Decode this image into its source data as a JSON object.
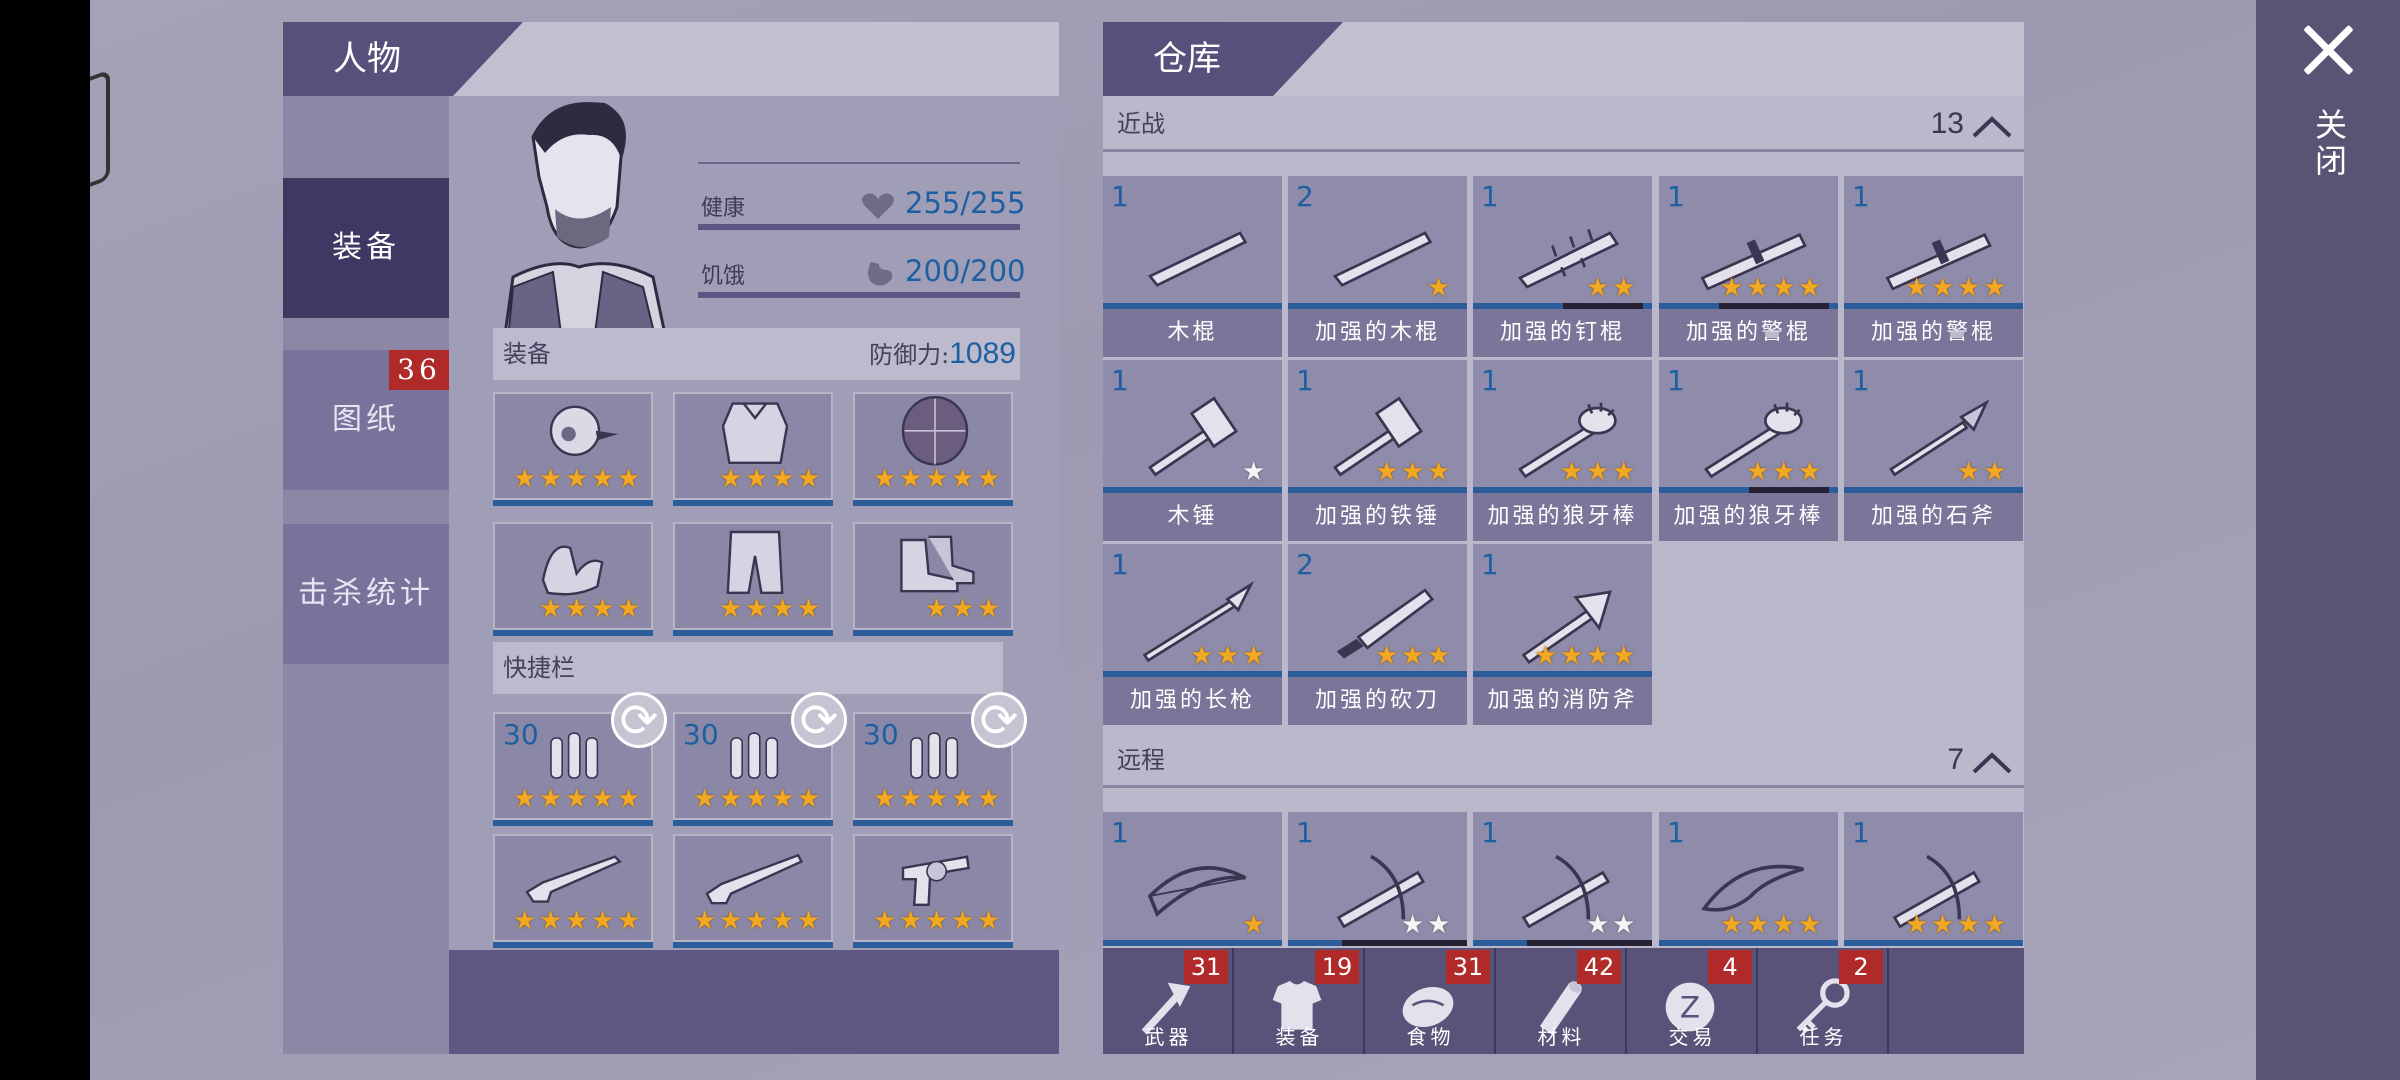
{
  "close": {
    "label": "关闭"
  },
  "character": {
    "title": "人物",
    "nav": [
      {
        "label": "装备",
        "active": true
      },
      {
        "label": "图纸",
        "badge": "36"
      },
      {
        "label": "击杀统计"
      }
    ],
    "health": {
      "label": "健康",
      "value": "255/255"
    },
    "hunger": {
      "label": "饥饿",
      "value": "200/200"
    },
    "equip_section": {
      "label": "装备",
      "defense_label": "防御力:",
      "defense_value": "1089"
    },
    "equipment": [
      {
        "icon": "helmet-icon",
        "stars": 5
      },
      {
        "icon": "armor-icon",
        "stars": 4
      },
      {
        "icon": "shield-icon",
        "stars": 5
      },
      {
        "icon": "gloves-icon",
        "stars": 4
      },
      {
        "icon": "pants-icon",
        "stars": 4
      },
      {
        "icon": "boots-icon",
        "stars": 3
      }
    ],
    "quick_section": {
      "label": "快捷栏"
    },
    "ammo": [
      {
        "icon": "ammo-icon",
        "qty": "30",
        "stars": 5
      },
      {
        "icon": "ammo-icon",
        "qty": "30",
        "stars": 5
      },
      {
        "icon": "ammo-icon",
        "qty": "30",
        "stars": 5
      }
    ],
    "guns": [
      {
        "icon": "rifle-icon",
        "stars": 5
      },
      {
        "icon": "shotgun-icon",
        "stars": 5
      },
      {
        "icon": "revolver-icon",
        "stars": 5
      }
    ]
  },
  "warehouse": {
    "title": "仓库",
    "melee": {
      "label": "近战",
      "count": "13"
    },
    "ranged": {
      "label": "远程",
      "count": "7"
    },
    "melee_items": [
      {
        "qty": "1",
        "name": "木棍",
        "stars": 0,
        "icon": "stick-icon"
      },
      {
        "qty": "2",
        "name": "加强的木棍",
        "stars": 1,
        "icon": "stick-icon"
      },
      {
        "qty": "1",
        "name": "加强的钉棍",
        "stars": 2,
        "icon": "nail-bat-icon"
      },
      {
        "qty": "1",
        "name": "加强的警棍",
        "stars": 4,
        "icon": "baton-icon"
      },
      {
        "qty": "1",
        "name": "加强的警棍",
        "stars": 4,
        "icon": "baton-icon"
      },
      {
        "qty": "1",
        "name": "木锤",
        "stars": 1,
        "white": true,
        "icon": "hammer-icon"
      },
      {
        "qty": "1",
        "name": "加强的铁锤",
        "stars": 3,
        "icon": "hammer-icon"
      },
      {
        "qty": "1",
        "name": "加强的狼牙棒",
        "stars": 3,
        "icon": "mace-icon"
      },
      {
        "qty": "1",
        "name": "加强的狼牙棒",
        "stars": 3,
        "icon": "mace-icon"
      },
      {
        "qty": "1",
        "name": "加强的石斧",
        "stars": 2,
        "icon": "stone-spear-icon"
      },
      {
        "qty": "1",
        "name": "加强的长枪",
        "stars": 3,
        "icon": "spear-icon"
      },
      {
        "qty": "2",
        "name": "加强的砍刀",
        "stars": 3,
        "icon": "machete-icon"
      },
      {
        "qty": "1",
        "name": "加强的消防斧",
        "stars": 4,
        "icon": "fire-axe-icon"
      }
    ],
    "ranged_items": [
      {
        "qty": "1",
        "stars": 1,
        "icon": "bow-icon"
      },
      {
        "qty": "1",
        "stars": 2,
        "white": true,
        "icon": "crossbow-icon"
      },
      {
        "qty": "1",
        "stars": 2,
        "white": true,
        "icon": "crossbow-icon"
      },
      {
        "qty": "1",
        "stars": 4,
        "icon": "recurve-bow-icon"
      },
      {
        "qty": "1",
        "stars": 4,
        "icon": "crossbow-icon"
      }
    ],
    "tabs": [
      {
        "label": "武器",
        "badge": "31",
        "icon": "axe-icon"
      },
      {
        "label": "装备",
        "badge": "19",
        "icon": "shirt-icon"
      },
      {
        "label": "食物",
        "badge": "31",
        "icon": "meat-icon"
      },
      {
        "label": "材料",
        "badge": "42",
        "icon": "log-icon"
      },
      {
        "label": "交易",
        "badge": "4",
        "icon": "coin-icon"
      },
      {
        "label": "任务",
        "badge": "2",
        "icon": "key-icon"
      }
    ]
  }
}
